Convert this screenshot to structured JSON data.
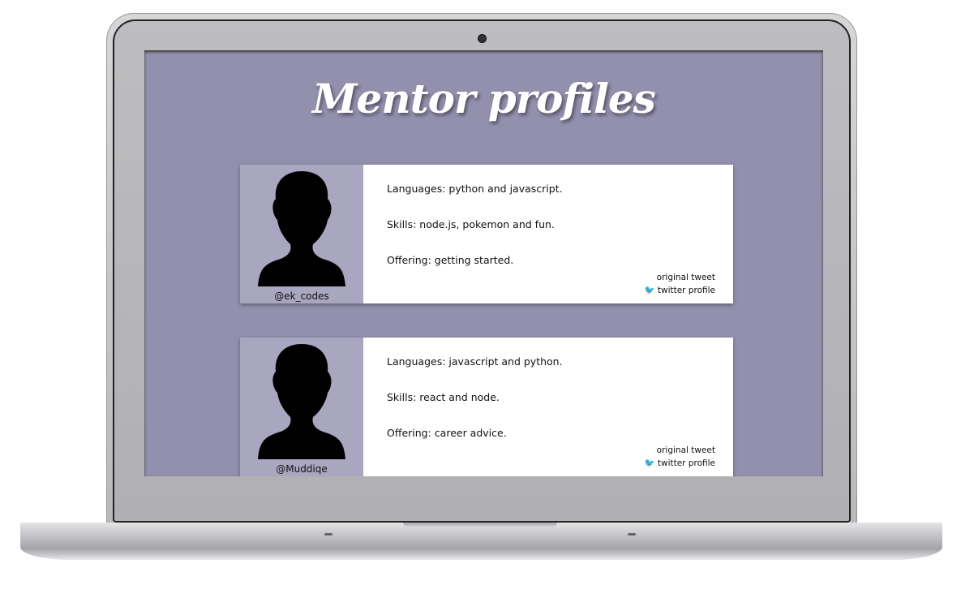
{
  "page": {
    "title": "Mentor profiles"
  },
  "mentors": [
    {
      "handle": "@ek_codes",
      "languages": "Languages: python and javascript.",
      "skills": "Skills: node.js, pokemon and fun.",
      "offering": "Offering: getting started.",
      "original_tweet": "original tweet",
      "twitter_profile": "twitter profile"
    },
    {
      "handle": "@Muddiqe",
      "languages": "Languages: javascript and python.",
      "skills": "Skills: react and node.",
      "offering": "Offering: career advice.",
      "original_tweet": "original tweet",
      "twitter_profile": "twitter profile"
    }
  ],
  "colors": {
    "background": "#9390ae",
    "photo_panel": "#a9a6bf",
    "card": "#ffffff"
  }
}
